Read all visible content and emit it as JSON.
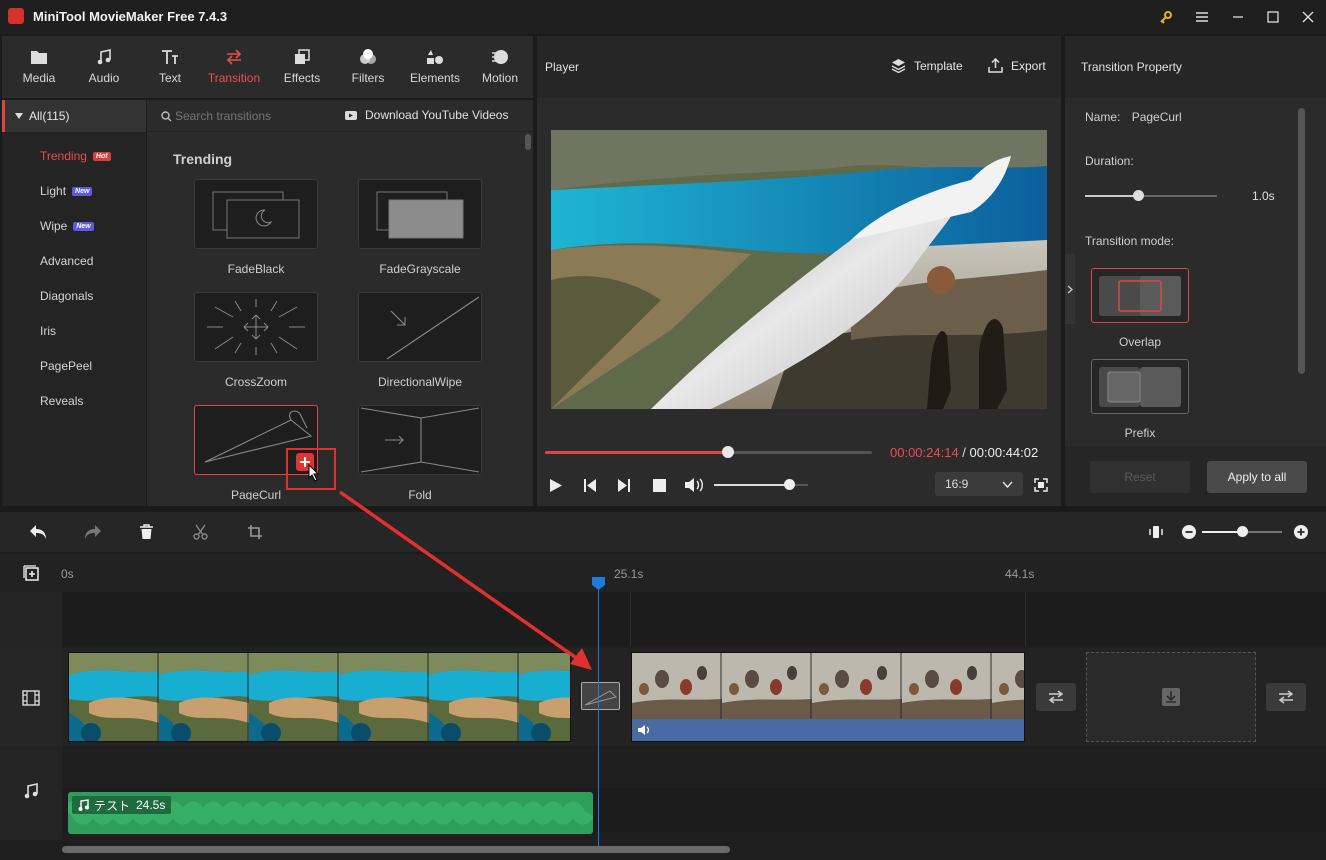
{
  "app": {
    "title": "MiniTool MovieMaker Free 7.4.3"
  },
  "toolbar": {
    "tabs": [
      {
        "label": "Media",
        "icon": "folder-icon"
      },
      {
        "label": "Audio",
        "icon": "music-note-icon"
      },
      {
        "label": "Text",
        "icon": "text-icon"
      },
      {
        "label": "Transition",
        "icon": "transition-arrows-icon",
        "active": true
      },
      {
        "label": "Effects",
        "icon": "effects-icon"
      },
      {
        "label": "Filters",
        "icon": "filters-icon"
      },
      {
        "label": "Elements",
        "icon": "elements-icon"
      },
      {
        "label": "Motion",
        "icon": "motion-icon"
      }
    ]
  },
  "categories": {
    "all_label": "All(115)",
    "items": [
      {
        "label": "Trending",
        "badge": "Hot",
        "active": true
      },
      {
        "label": "Light",
        "badge": "New"
      },
      {
        "label": "Wipe",
        "badge": "New"
      },
      {
        "label": "Advanced"
      },
      {
        "label": "Diagonals"
      },
      {
        "label": "Iris"
      },
      {
        "label": "PagePeel"
      },
      {
        "label": "Reveals"
      }
    ]
  },
  "search": {
    "placeholder": "Search transitions",
    "download_label": "Download YouTube Videos"
  },
  "transitions": {
    "section_title": "Trending",
    "items": [
      "FadeBlack",
      "FadeGrayscale",
      "CrossZoom",
      "DirectionalWipe",
      "PageCurl",
      "Fold"
    ]
  },
  "player": {
    "title": "Player",
    "template_label": "Template",
    "export_label": "Export",
    "current_time": "00:00:24:14",
    "separator": " / ",
    "total_time": "00:00:44:02",
    "progress": 0.56,
    "volume": 0.8,
    "aspect_ratio": "16:9"
  },
  "property": {
    "title": "Transition Property",
    "name_label": "Name:",
    "name_value": "PageCurl",
    "duration_label": "Duration:",
    "duration_value": "1.0s",
    "duration_level": 0.4,
    "mode_label": "Transition mode:",
    "modes": [
      "Overlap",
      "Prefix"
    ],
    "reset_label": "Reset",
    "apply_label": "Apply to all"
  },
  "timeline": {
    "ruler": [
      "0s",
      "25.1s",
      "44.1s"
    ],
    "audio_clip_name": "テスト",
    "audio_clip_duration": "24.5s",
    "zoom_level": 0.5
  },
  "colors": {
    "accent": "#e04545",
    "playhead": "#1f7ae0",
    "audio": "#2f9e5b",
    "video_clip_bar": "#4a6aa6"
  }
}
